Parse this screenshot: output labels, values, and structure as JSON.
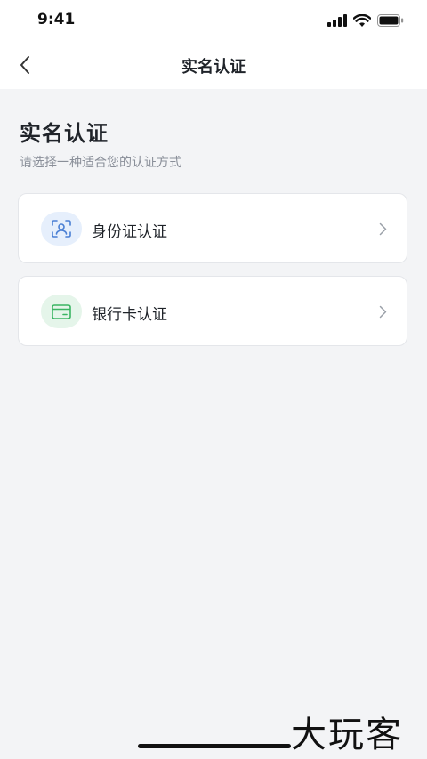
{
  "status_bar": {
    "time": "9:41",
    "icons": [
      "signal-icon",
      "wifi-icon",
      "battery-icon"
    ]
  },
  "nav": {
    "back_icon": "chevron-left-icon",
    "title": "实名认证"
  },
  "heading": {
    "title": "实名认证",
    "subtitle": "请选择一种适合您的认证方式"
  },
  "options": [
    {
      "label": "身份证认证",
      "icon": "face-scan-icon",
      "icon_bg": "#e6effc",
      "icon_color": "#4a7fd4"
    },
    {
      "label": "银行卡认证",
      "icon": "bank-card-icon",
      "icon_bg": "#e5f5ea",
      "icon_color": "#3bb563"
    }
  ],
  "watermark": "大玩客",
  "colors": {
    "background": "#f3f4f6",
    "card": "#ffffff",
    "text_primary": "#1f2329",
    "text_secondary": "#8a8f99"
  }
}
